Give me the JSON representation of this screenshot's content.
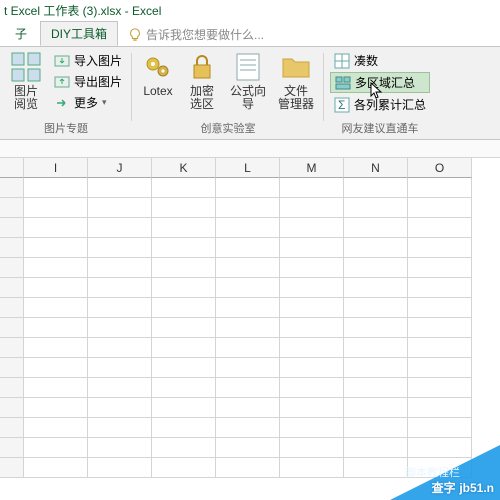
{
  "title": "t Excel 工作表 (3).xlsx - Excel",
  "tabs": {
    "t0": "子",
    "t1": "DIY工具箱",
    "tellme": "告诉我您想要做什么..."
  },
  "g1": {
    "label": "图片专题",
    "b0": "图片\n阅览",
    "s0": "导入图片",
    "s1": "导出图片",
    "s2": "更多"
  },
  "g2": {
    "label": "创意实验室",
    "b0": "Lotex",
    "b1": "加密\n选区",
    "b2": "公式向\n导",
    "b3": "文件\n管理器"
  },
  "g3": {
    "label": "网友建议直通车",
    "s0": "凑数",
    "s1": "多区域汇总",
    "s2": "各列累计汇总"
  },
  "cols": [
    "I",
    "J",
    "K",
    "L",
    "M",
    "N",
    "O"
  ],
  "watermark": {
    "line1": "查字",
    "line2": "jb51.n",
    "sub": "脚本教程栏"
  }
}
